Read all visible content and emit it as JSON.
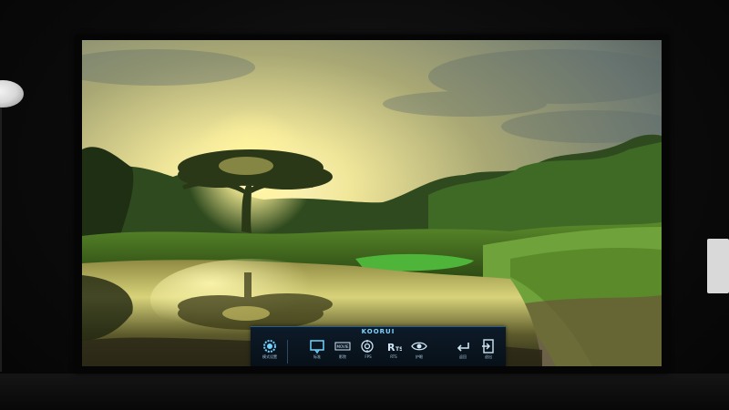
{
  "osd": {
    "brand": "KOORUI",
    "items": [
      {
        "icon": "gear-icon",
        "label": "模式设置"
      },
      {
        "icon": "monitor-icon",
        "label": "标准"
      },
      {
        "icon": "movie-icon",
        "label": "影院"
      },
      {
        "icon": "fps-icon",
        "label": "FPS"
      },
      {
        "icon": "rts-icon",
        "label": "RTS"
      },
      {
        "icon": "eye-icon",
        "label": "护眼"
      },
      {
        "icon": "return-icon",
        "label": "返回"
      },
      {
        "icon": "exit-icon",
        "label": "退出"
      }
    ],
    "accent_color": "#6fd3ff"
  }
}
